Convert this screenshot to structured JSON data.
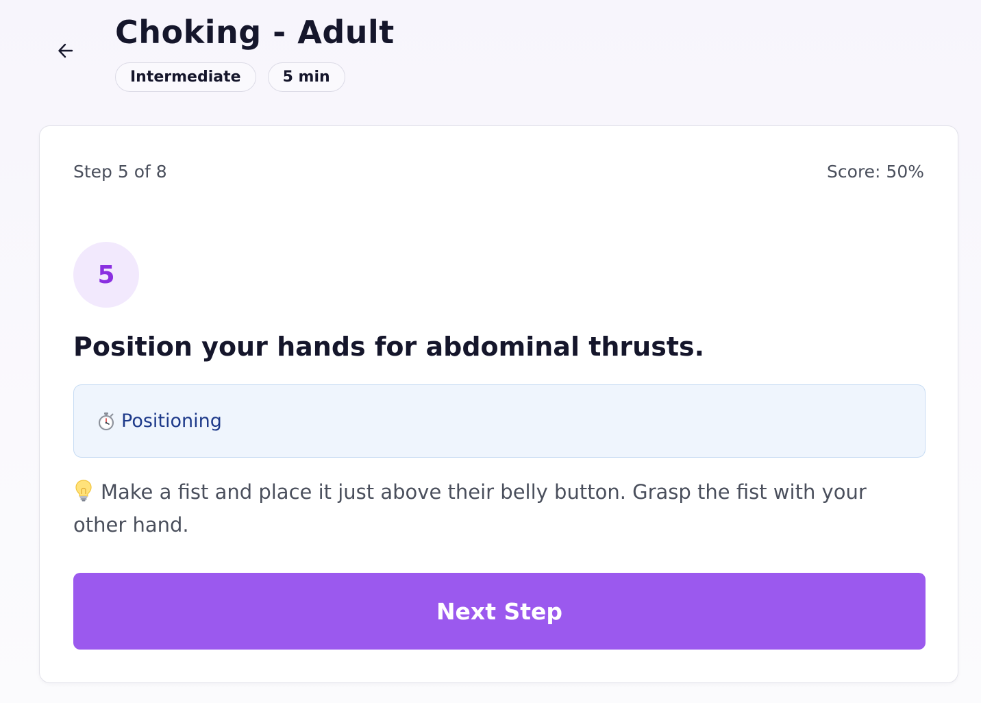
{
  "header": {
    "title": "Choking - Adult",
    "back_icon": "arrow-left-icon",
    "badges": [
      "Intermediate",
      "5 min"
    ]
  },
  "card": {
    "step_label": "Step 5 of 8",
    "score_label": "Score: 50%",
    "step_number": "5",
    "step_title": "Position your hands for abdominal thrusts.",
    "info": {
      "icon": "stopwatch-icon",
      "label": "Positioning"
    },
    "tip": {
      "icon": "lightbulb-icon",
      "text": "Make a fist and place it just above their belly button. Grasp the fist with your other hand."
    },
    "next_button_label": "Next Step"
  },
  "colors": {
    "accent": "#9b59ee",
    "step_circle_bg": "#f2e9fd",
    "step_circle_text": "#8a2fe0",
    "info_bg": "#eff5fd",
    "info_border": "#c6dbf3",
    "info_text": "#1e3a8a"
  }
}
